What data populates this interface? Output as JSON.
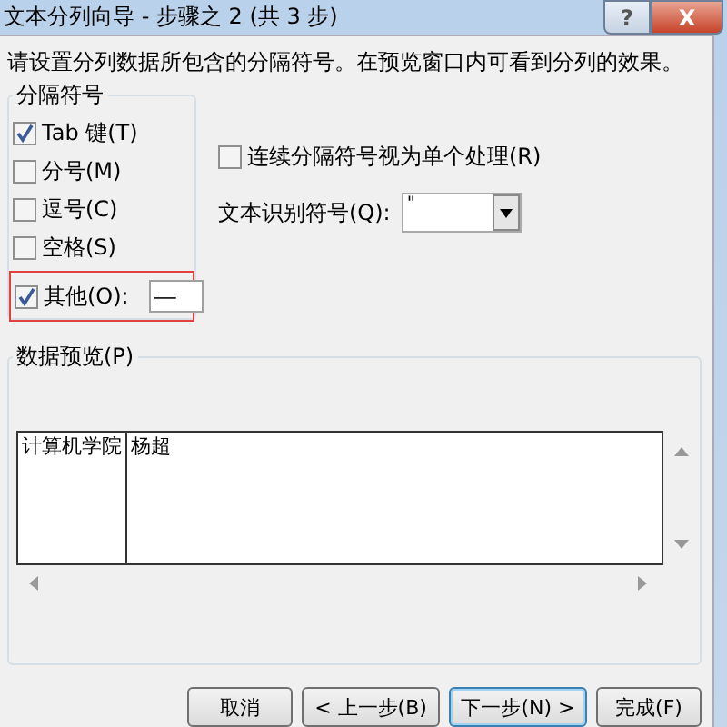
{
  "window": {
    "title": "文本分列向导 - 步骤之 2 (共 3 步)",
    "help": "?",
    "close": "X"
  },
  "instruction": "请设置分列数据所包含的分隔符号。在预览窗口内可看到分列的效果。",
  "delimiters": {
    "title": "分隔符号",
    "options": [
      {
        "label": "Tab 键(T)",
        "checked": true
      },
      {
        "label": "分号(M)",
        "checked": false
      },
      {
        "label": "逗号(C)",
        "checked": false
      },
      {
        "label": "空格(S)",
        "checked": false
      }
    ],
    "other": {
      "label": "其他(O):",
      "checked": true,
      "value": "—",
      "highlighted": true
    }
  },
  "consecutive": {
    "label": "连续分隔符号视为单个处理(R)",
    "checked": false
  },
  "text_qualifier": {
    "label": "文本识别符号(Q):",
    "value": "\""
  },
  "preview": {
    "title": "数据预览(P)",
    "rows": [
      [
        "计算机学院",
        "杨超"
      ]
    ]
  },
  "buttons": [
    {
      "label": "取消",
      "default": false
    },
    {
      "label": "< 上一步(B)",
      "default": false
    },
    {
      "label": "下一步(N) >",
      "default": true
    },
    {
      "label": "完成(F)",
      "default": false
    }
  ]
}
